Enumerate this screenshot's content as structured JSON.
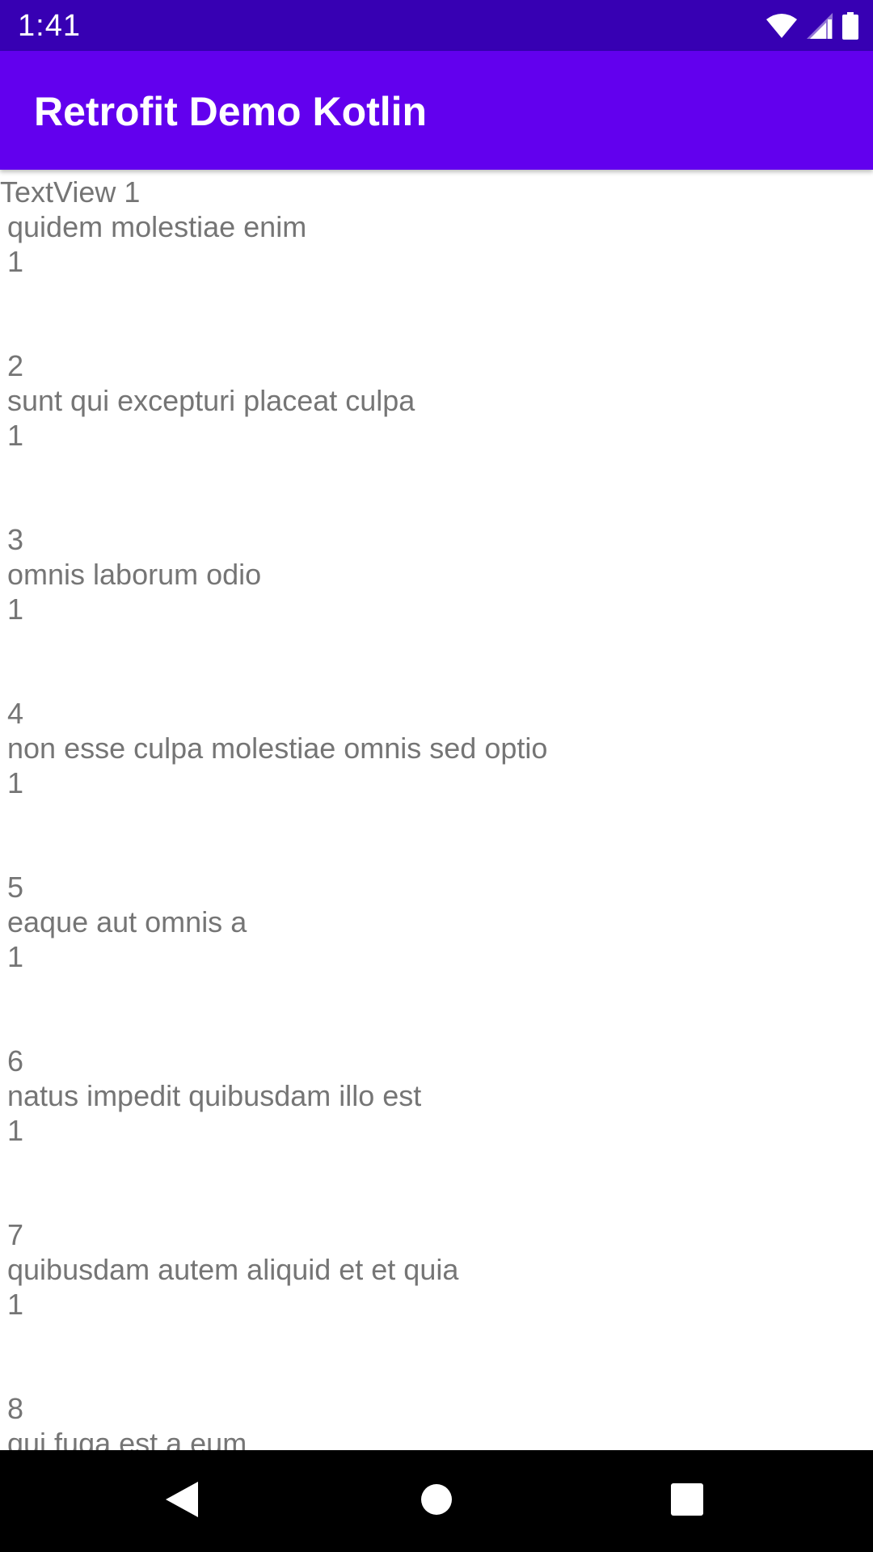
{
  "status_bar": {
    "time": "1:41",
    "icons": [
      "wifi-icon",
      "cell-signal-icon",
      "battery-icon"
    ]
  },
  "app_bar": {
    "title": "Retrofit Demo Kotlin",
    "color": "#6200EE"
  },
  "colors": {
    "status_bar": "#3700B3",
    "text": "#757575"
  },
  "list": {
    "items": [
      {
        "id": "TextView 1",
        "title": "quidem molestiae enim",
        "user": "1"
      },
      {
        "id": "2",
        "title": "sunt qui excepturi placeat culpa",
        "user": "1"
      },
      {
        "id": "3",
        "title": "omnis laborum odio",
        "user": "1"
      },
      {
        "id": "4",
        "title": "non esse culpa molestiae omnis sed optio",
        "user": "1"
      },
      {
        "id": "5",
        "title": "eaque aut omnis a",
        "user": "1"
      },
      {
        "id": "6",
        "title": "natus impedit quibusdam illo est",
        "user": "1"
      },
      {
        "id": "7",
        "title": "quibusdam autem aliquid et et quia",
        "user": "1"
      },
      {
        "id": "8",
        "title": "qui fuga est a eum",
        "user": ""
      }
    ]
  },
  "nav_bar": {
    "buttons": [
      "back-icon",
      "home-icon",
      "recents-icon"
    ]
  }
}
